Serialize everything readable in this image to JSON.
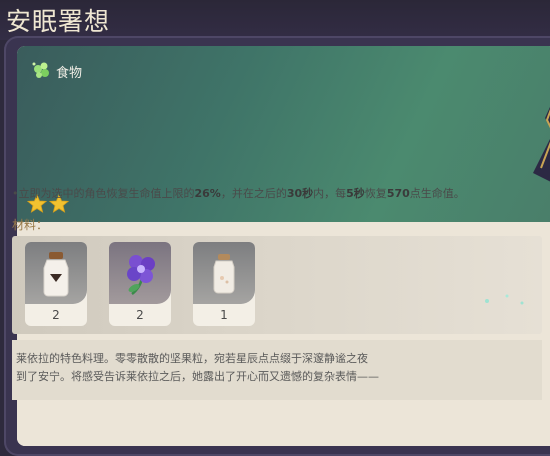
{
  "title": "安眠署想",
  "item": {
    "type_label": "食物",
    "stars": 2,
    "icons": {
      "type": "food-leaf-icon",
      "star": "star-icon"
    },
    "colors": {
      "header": "#3f7468",
      "star": "#f2c230",
      "highlight": "#3a3a3a"
    }
  },
  "effect": {
    "prefix": "•立即为选中的角色恢复生命值上限的",
    "pct": "26%",
    "mid1": "，并在之后的",
    "duration": "30秒",
    "mid2": "内，每",
    "interval": "5秒",
    "mid3": "恢复",
    "amount": "570",
    "suffix": "点生命值。"
  },
  "materials_label": "材料：",
  "materials": [
    {
      "count": "2",
      "icon": "salt-jar-icon"
    },
    {
      "count": "2",
      "icon": "purple-flower-icon"
    },
    {
      "count": "1",
      "icon": "jar-icon"
    }
  ],
  "description": [
    "莱依拉的特色料理。零零散散的坚果粒，宛若星辰点点缀于深邃静谧之夜",
    "到了安宁。将感受告诉莱依拉之后，她露出了开心而又遗憾的复杂表情——"
  ]
}
